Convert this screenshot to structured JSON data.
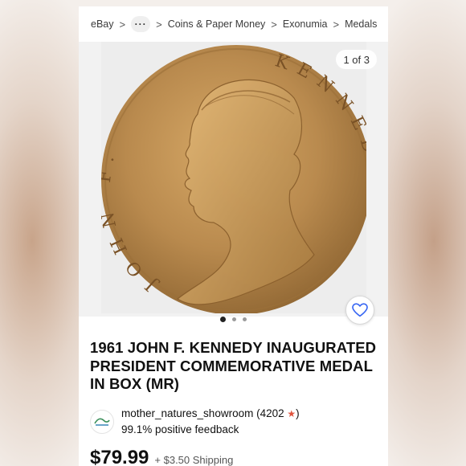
{
  "breadcrumb": {
    "items": [
      "eBay",
      "Coins & Paper Money",
      "Exonumia",
      "Medals"
    ],
    "more_label": "···",
    "separator": ">"
  },
  "gallery": {
    "counter": "1 of 3",
    "medal_left_text": "JOHN F.",
    "medal_right_text": "KENNEDY",
    "dot_count": 3,
    "active_dot": 1
  },
  "listing": {
    "title": "1961 JOHN F. KENNEDY INAUGURATED PRESIDENT COMMEMORATIVE MEDAL IN BOX (MR)",
    "price": "$79.99",
    "shipping": "+ $3.50 Shipping"
  },
  "seller": {
    "name": "mother_natures_showroom",
    "score": "(4202",
    "score_close": ")",
    "feedback": "99.1% positive feedback"
  },
  "colors": {
    "medal_bronze": "#b98a4e",
    "star": "#e0533d"
  },
  "icons": {
    "favorite": "heart-outline-icon",
    "star": "star-icon",
    "chevron": "chevron-right-icon"
  }
}
